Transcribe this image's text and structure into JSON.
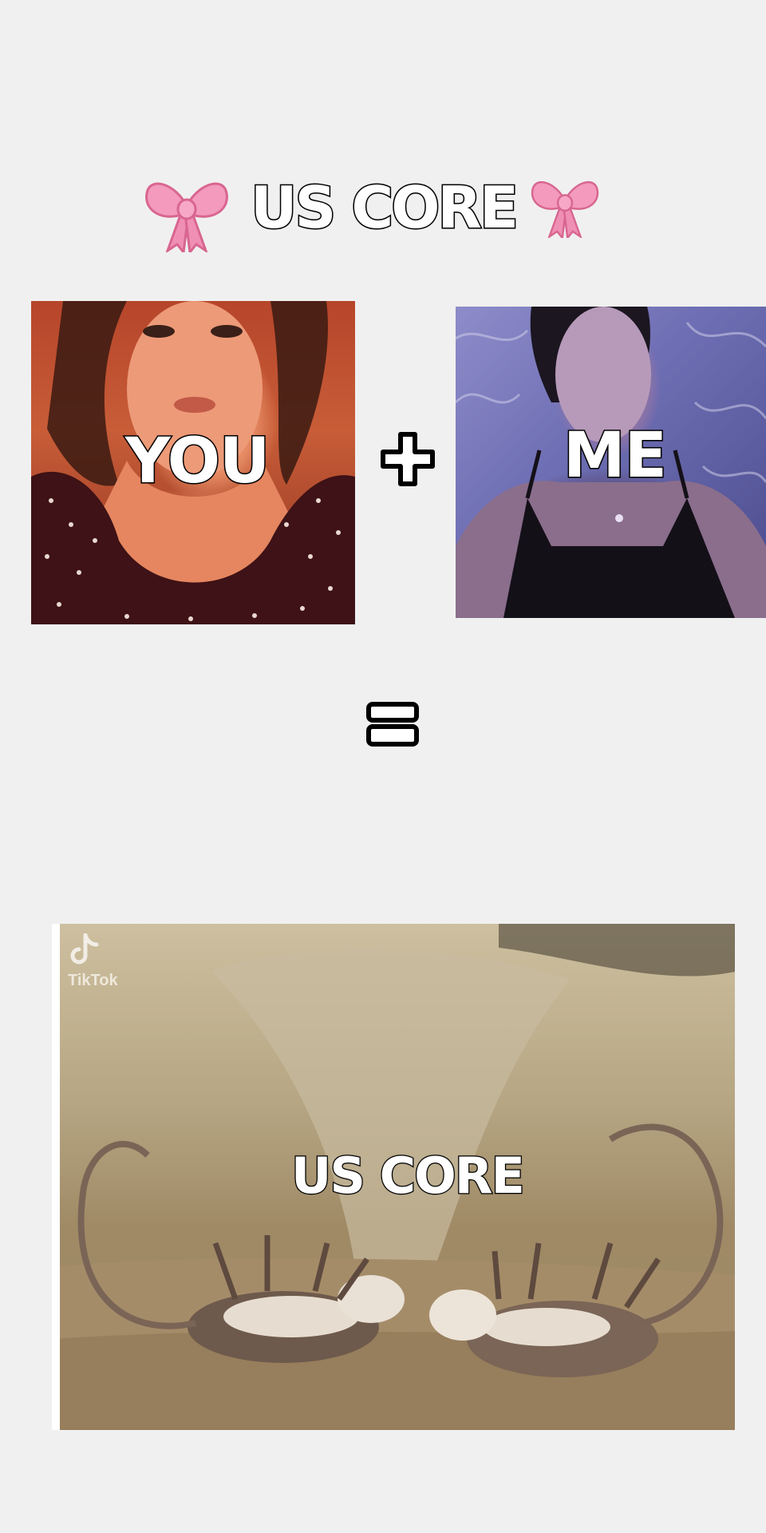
{
  "header": {
    "title": "US CORE",
    "left_icon": "bow-icon",
    "right_icon": "bow-icon"
  },
  "photos": {
    "you_label": "YOU",
    "me_label": "ME"
  },
  "operators": {
    "plus_icon": "plus-icon",
    "equals_icon": "equals-icon"
  },
  "meme": {
    "caption": "US CORE",
    "watermark_brand": "TikTok",
    "watermark_icon": "tiktok-logo-icon"
  },
  "colors": {
    "background": "#f0f0f0",
    "bow_pink": "#f08fb4",
    "text_fill": "#ffffff",
    "text_outline": "#000000"
  }
}
